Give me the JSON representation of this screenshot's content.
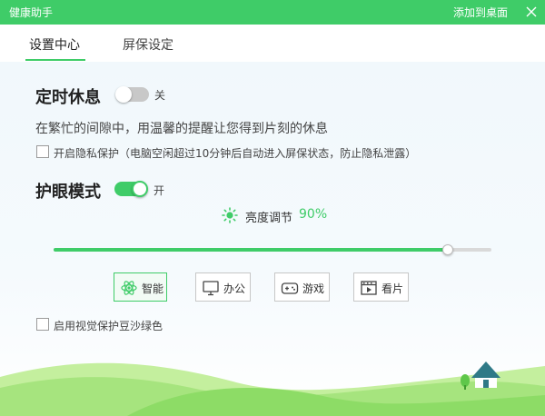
{
  "window": {
    "title": "健康助手",
    "add_to_desktop": "添加到桌面",
    "close_icon": "close-icon"
  },
  "tabs": [
    {
      "label": "设置中心",
      "active": true
    },
    {
      "label": "屏保设定",
      "active": false
    }
  ],
  "rest_timer": {
    "title": "定时休息",
    "enabled": false,
    "state_label": "关",
    "description": "在繁忙的间隙中，用温馨的提醒让您得到片刻的休息",
    "privacy_checkbox_label": "开启隐私保护（电脑空闲超过10分钟后自动进入屏保状态，防止隐私泄露）",
    "privacy_checked": false
  },
  "eye_care": {
    "title": "护眼模式",
    "enabled": true,
    "state_label": "开",
    "brightness_label": "亮度调节",
    "brightness_value": "90%",
    "brightness_fraction": 0.9,
    "modes": [
      {
        "label": "智能",
        "icon": "smart-atom-icon",
        "active": true
      },
      {
        "label": "办公",
        "icon": "monitor-icon",
        "active": false
      },
      {
        "label": "游戏",
        "icon": "gamepad-icon",
        "active": false
      },
      {
        "label": "看片",
        "icon": "film-icon",
        "active": false
      }
    ],
    "green_bg_checkbox_label": "启用视觉保护豆沙绿色",
    "green_bg_checked": false
  },
  "colors": {
    "accent": "#3fcc68",
    "track": "#d9d9d9"
  }
}
